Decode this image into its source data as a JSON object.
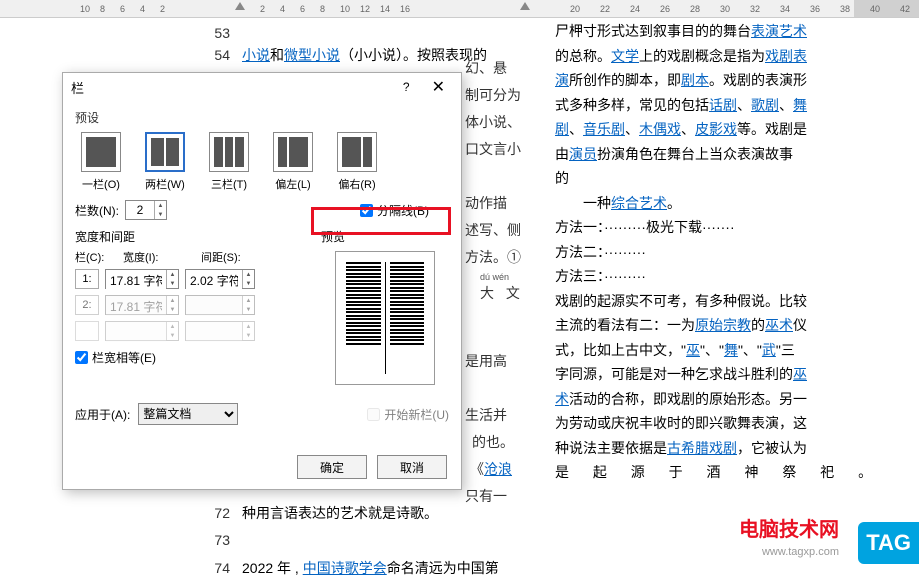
{
  "ruler": {
    "ticks": [
      "10",
      "8",
      "6",
      "4",
      "2",
      "",
      "2",
      "4",
      "6",
      "8",
      "10",
      "12",
      "14",
      "16",
      "",
      "20",
      "22",
      "24",
      "26",
      "28",
      "30",
      "32",
      "34",
      "36",
      "38",
      "40",
      "42"
    ]
  },
  "doc_left": {
    "l53": {
      "num": "53"
    },
    "l54": {
      "num": "54",
      "t1": "小说",
      "t2": "和",
      "t3": "微型小说",
      "t4": "（小小说）。按照表现的"
    },
    "l72": {
      "num": "72",
      "text": "种用言语表达的艺术就是诗歌。"
    },
    "l73": {
      "num": "73"
    },
    "l74": {
      "num": "74",
      "t1": "2022 年 , ",
      "t2": "中国诗歌学会",
      "t3": "命名清远为中国第"
    }
  },
  "bg_fragments": {
    "f1": "幻、悬",
    "f2": "制可分为",
    "f3": "体小说、",
    "f4": "口文言小",
    "f5": "动作描",
    "f6": "述写、侧",
    "f7": "方法。①",
    "f8": "dú   wén",
    "f9": "大  文",
    "f10": "是用高",
    "f11": "生活并",
    "f12": "的也。",
    "f13": "《沧浪",
    "f14": "只有一"
  },
  "doc_right": {
    "l1": {
      "t1": "尸柙寸形式达到叙事目的的舞台",
      "t2": "表演艺术"
    },
    "l2": {
      "t1": "的总称。",
      "t2": "文学",
      "t3": "上的戏剧概念是指为",
      "t4": "戏剧表"
    },
    "l3": {
      "t1": "演",
      "t2": "所创作的脚本，即",
      "t3": "剧本",
      "t4": "。戏剧的表演形"
    },
    "l4": {
      "t1": "式多种多样，常见的包括",
      "t2": "话剧",
      "t3": "、",
      "t4": "歌剧",
      "t5": "、",
      "t6": "舞"
    },
    "l5": {
      "t1": "剧",
      "t2": "、",
      "t3": "音乐剧",
      "t4": "、",
      "t5": "木偶戏",
      "t6": "、",
      "t7": "皮影戏",
      "t8": "等。戏剧是"
    },
    "l6": {
      "t1": "由",
      "t2": "演员",
      "t3": "扮演角色在舞台上当众表演故事"
    },
    "l7": {
      "t1": "的"
    },
    "l8": {
      "t1": "一种",
      "t2": "综合艺术",
      "t3": "。"
    },
    "m1": {
      "label": "方法一：",
      "dots": "·········",
      "mid": "极光下载",
      "dots2": "·······"
    },
    "m2": {
      "label": "方法二：",
      "dots": "·········"
    },
    "m3": {
      "label": "方法三：",
      "dots": "·········"
    },
    "p1": "戏剧的起源实不可考，有多种假说。比较",
    "p2": {
      "t1": "主流的看法有二：一为",
      "t2": "原始宗教",
      "t3": "的",
      "t4": "巫术",
      "t5": "仪"
    },
    "p3": {
      "t1": "式，比如上古中文，\"",
      "t2": "巫",
      "t3": "\"、\"",
      "t4": "舞",
      "t5": "\"、\"",
      "t6": "武",
      "t7": "\"三"
    },
    "p4": {
      "t1": "字同源，可能是对一种乞求战斗胜利的",
      "t2": "巫"
    },
    "p5": {
      "t1": "术",
      "t2": "活动的合称，即戏剧的原始形态。另一"
    },
    "p6": "为劳动或庆祝丰收时的即兴歌舞表演，这",
    "p7": {
      "t1": "种说法主要依据是",
      "t2": "古希腊戏剧",
      "t3": "，它被认为"
    },
    "p8": "是 起 源 于 酒 神 祭 祀 。"
  },
  "dialog": {
    "title": "栏",
    "help": "?",
    "presets_label": "预设",
    "presets": {
      "one": "一栏(O)",
      "two": "两栏(W)",
      "three": "三栏(T)",
      "left": "偏左(L)",
      "right": "偏右(R)"
    },
    "num_cols_label": "栏数(N):",
    "num_cols_value": "2",
    "sep_label": "分隔线(B)",
    "width_label": "宽度和间距",
    "preview_label": "预览",
    "col_h": "栏(C):",
    "width_h": "宽度(I):",
    "gap_h": "间距(S):",
    "row1_idx": "1:",
    "row1_w": "17.81 字符",
    "row1_g": "2.02 字符",
    "row2_idx": "2:",
    "row2_w": "17.81 字符",
    "row2_g": "",
    "equal_label": "栏宽相等(E)",
    "apply_label": "应用于(A):",
    "apply_value": "整篇文档",
    "newcol_label": "开始新栏(U)",
    "ok": "确定",
    "cancel": "取消"
  },
  "watermark": {
    "brand": "电脑技术网",
    "url": "www.tagxp.com",
    "tag": "TAG"
  }
}
